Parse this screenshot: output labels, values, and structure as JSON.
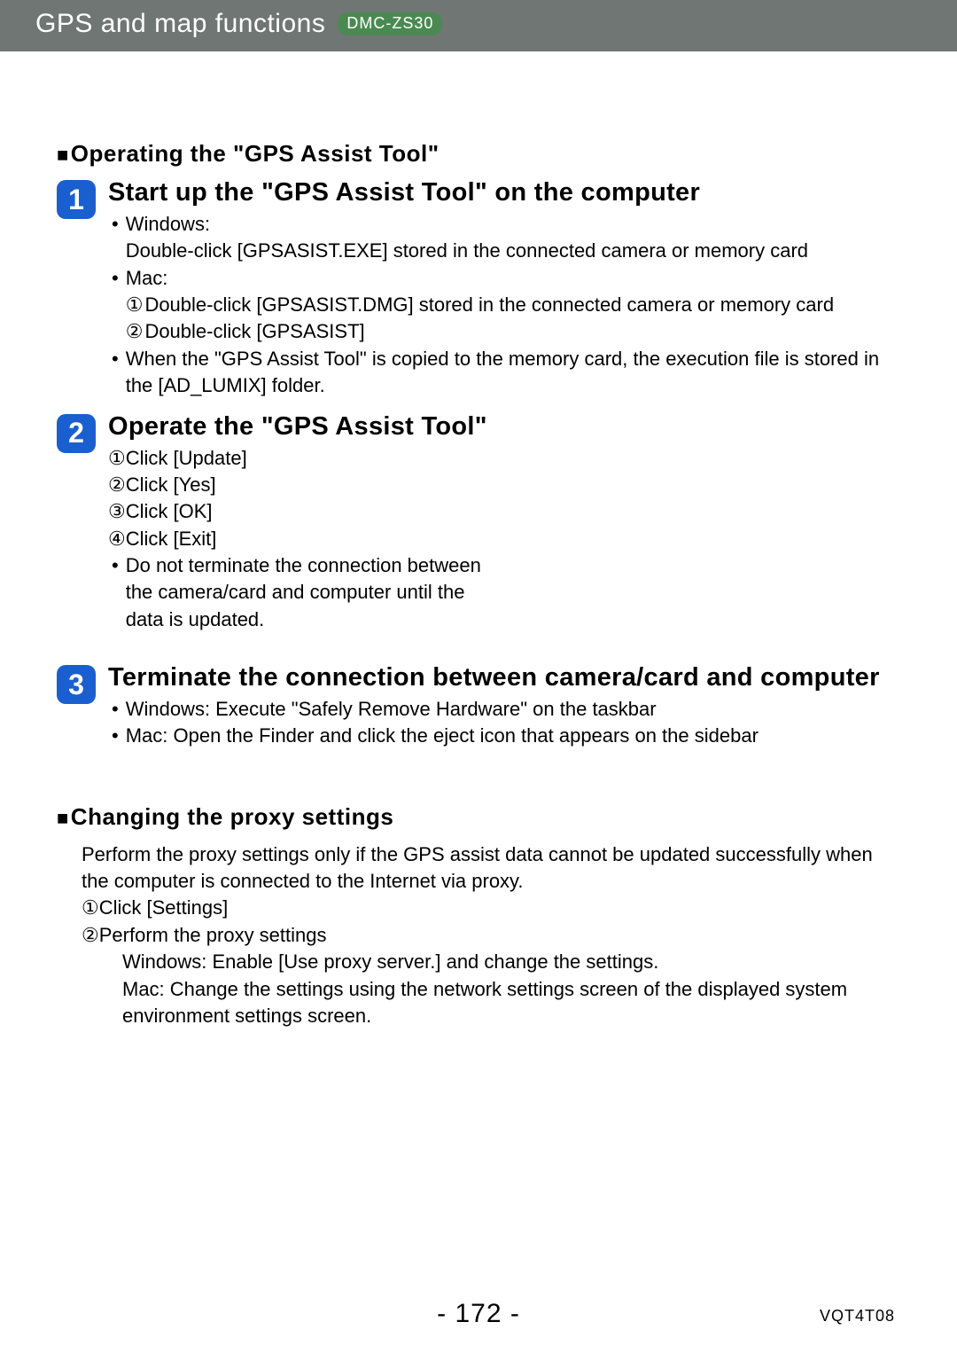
{
  "header": {
    "title": "GPS and map functions",
    "model": "DMC-ZS30"
  },
  "section1": {
    "heading": "Operating the \"GPS Assist Tool\""
  },
  "step1": {
    "num": "1",
    "title": "Start up the \"GPS Assist Tool\" on the computer",
    "win_label": "Windows:",
    "win_text": "Double-click [GPSASIST.EXE] stored in the connected camera or memory card",
    "mac_label": "Mac:",
    "mac_line1_num": "①",
    "mac_line1": "Double-click [GPSASIST.DMG] stored in the connected camera or memory card",
    "mac_line2_num": "②",
    "mac_line2": "Double-click [GPSASIST]",
    "note": "When the \"GPS Assist Tool\" is copied to the memory card, the execution file is stored in the [AD_LUMIX] folder."
  },
  "step2": {
    "num": "2",
    "title": "Operate the \"GPS Assist Tool\"",
    "l1n": "①",
    "l1": " Click [Update]",
    "l2n": "②",
    "l2": " Click [Yes]",
    "l3n": "③",
    "l3": " Click [OK]",
    "l4n": "④",
    "l4": " Click [Exit]",
    "note": "Do not terminate the connection between the camera/card and computer until the data is updated."
  },
  "step3": {
    "num": "3",
    "title": "Terminate the connection between camera/card and computer",
    "win": "Windows: Execute \"Safely Remove Hardware\" on the taskbar",
    "mac": "Mac: Open the Finder and click the eject icon that appears on the sidebar"
  },
  "proxy": {
    "heading": "Changing the proxy settings",
    "intro": "Perform the proxy settings only if the GPS assist data cannot be updated successfully when the computer is connected to the Internet via proxy.",
    "l1n": "①",
    "l1": "Click [Settings]",
    "l2n": "②",
    "l2": "Perform the proxy settings",
    "win": "Windows: Enable [Use proxy server.] and change the settings.",
    "mac": "Mac: Change the settings using the network settings screen of the displayed system environment settings screen."
  },
  "footer": {
    "page": "- 172 -",
    "code": "VQT4T08"
  }
}
